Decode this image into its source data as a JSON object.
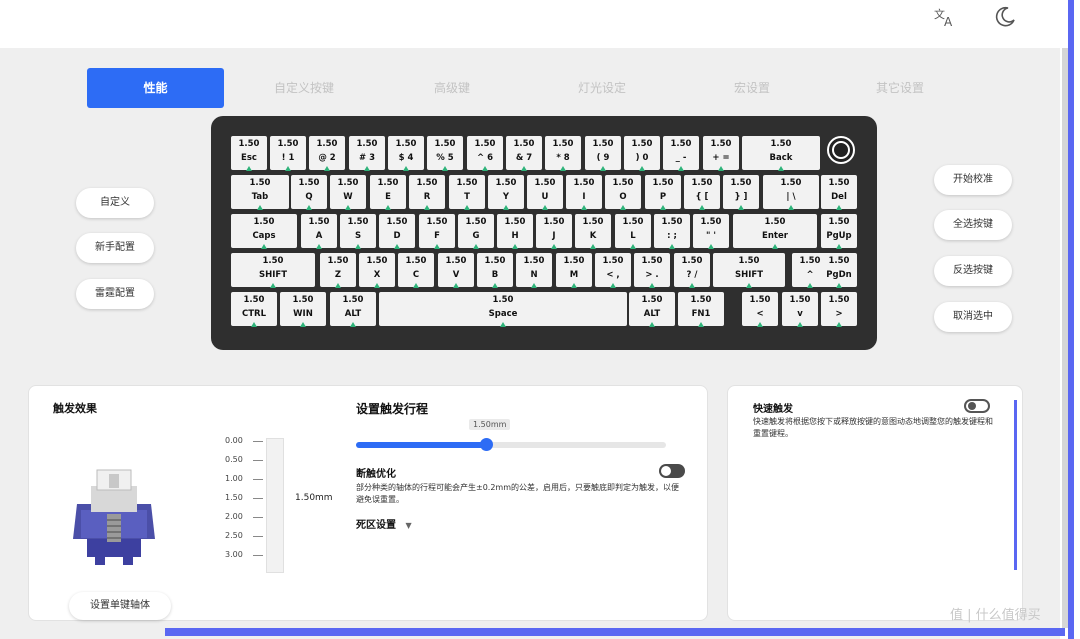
{
  "topbar": {
    "translate_icon": "translate-icon",
    "theme_icon": "moon-icon"
  },
  "tabs": [
    {
      "label": "性能",
      "active": true
    },
    {
      "label": "自定义按键",
      "active": false
    },
    {
      "label": "高级键",
      "active": false
    },
    {
      "label": "灯光设定",
      "active": false
    },
    {
      "label": "宏设置",
      "active": false
    },
    {
      "label": "其它设置",
      "active": false
    }
  ],
  "keyboard": {
    "accent": "#2fb37a",
    "rows": [
      [
        {
          "v": "1.50",
          "l": "Esc"
        },
        {
          "v": "1.50",
          "l": "! 1"
        },
        {
          "v": "1.50",
          "l": "@ 2"
        },
        {
          "v": "1.50",
          "l": "# 3"
        },
        {
          "v": "1.50",
          "l": "$ 4"
        },
        {
          "v": "1.50",
          "l": "% 5"
        },
        {
          "v": "1.50",
          "l": "^ 6"
        },
        {
          "v": "1.50",
          "l": "& 7"
        },
        {
          "v": "1.50",
          "l": "* 8"
        },
        {
          "v": "1.50",
          "l": "( 9"
        },
        {
          "v": "1.50",
          "l": ") 0"
        },
        {
          "v": "1.50",
          "l": "_ -"
        },
        {
          "v": "1.50",
          "l": "+ ="
        },
        {
          "v": "1.50",
          "l": "Back"
        }
      ],
      [
        {
          "v": "1.50",
          "l": "Tab"
        },
        {
          "v": "1.50",
          "l": "Q"
        },
        {
          "v": "1.50",
          "l": "W"
        },
        {
          "v": "1.50",
          "l": "E"
        },
        {
          "v": "1.50",
          "l": "R"
        },
        {
          "v": "1.50",
          "l": "T"
        },
        {
          "v": "1.50",
          "l": "Y"
        },
        {
          "v": "1.50",
          "l": "U"
        },
        {
          "v": "1.50",
          "l": "I"
        },
        {
          "v": "1.50",
          "l": "O"
        },
        {
          "v": "1.50",
          "l": "P"
        },
        {
          "v": "1.50",
          "l": "{ ["
        },
        {
          "v": "1.50",
          "l": "} ]"
        },
        {
          "v": "1.50",
          "l": "| \\"
        },
        {
          "v": "1.50",
          "l": "Del"
        }
      ],
      [
        {
          "v": "1.50",
          "l": "Caps"
        },
        {
          "v": "1.50",
          "l": "A"
        },
        {
          "v": "1.50",
          "l": "S"
        },
        {
          "v": "1.50",
          "l": "D"
        },
        {
          "v": "1.50",
          "l": "F"
        },
        {
          "v": "1.50",
          "l": "G"
        },
        {
          "v": "1.50",
          "l": "H"
        },
        {
          "v": "1.50",
          "l": "J"
        },
        {
          "v": "1.50",
          "l": "K"
        },
        {
          "v": "1.50",
          "l": "L"
        },
        {
          "v": "1.50",
          "l": ": ;"
        },
        {
          "v": "1.50",
          "l": "\" '"
        },
        {
          "v": "1.50",
          "l": "Enter"
        },
        {
          "v": "1.50",
          "l": "PgUp"
        }
      ],
      [
        {
          "v": "1.50",
          "l": "SHIFT"
        },
        {
          "v": "1.50",
          "l": "Z"
        },
        {
          "v": "1.50",
          "l": "X"
        },
        {
          "v": "1.50",
          "l": "C"
        },
        {
          "v": "1.50",
          "l": "V"
        },
        {
          "v": "1.50",
          "l": "B"
        },
        {
          "v": "1.50",
          "l": "N"
        },
        {
          "v": "1.50",
          "l": "M"
        },
        {
          "v": "1.50",
          "l": "< ,"
        },
        {
          "v": "1.50",
          "l": "> ."
        },
        {
          "v": "1.50",
          "l": "? /"
        },
        {
          "v": "1.50",
          "l": "SHIFT"
        },
        {
          "v": "1.50",
          "l": "^"
        },
        {
          "v": "1.50",
          "l": "PgDn"
        }
      ],
      [
        {
          "v": "1.50",
          "l": "CTRL"
        },
        {
          "v": "1.50",
          "l": "WIN"
        },
        {
          "v": "1.50",
          "l": "ALT"
        },
        {
          "v": "1.50",
          "l": "Space"
        },
        {
          "v": "1.50",
          "l": "ALT"
        },
        {
          "v": "1.50",
          "l": "FN1"
        },
        {
          "v": "1.50",
          "l": "<"
        },
        {
          "v": "1.50",
          "l": "v"
        },
        {
          "v": "1.50",
          "l": ">"
        }
      ]
    ]
  },
  "left_buttons": [
    "自定义",
    "新手配置",
    "雷霆配置"
  ],
  "right_buttons": [
    "开始校准",
    "全选按键",
    "反选按键",
    "取消选中"
  ],
  "trigger_panel": {
    "title": "触发效果",
    "scale": [
      "0.00",
      "0.50",
      "1.00",
      "1.50",
      "2.00",
      "2.50",
      "3.00"
    ],
    "current_value": "1.50mm",
    "set_single_btn": "设置单键轴体"
  },
  "travel_panel": {
    "title": "设置触发行程",
    "slider_label": "1.50mm",
    "slider_fraction": 0.42,
    "optimize_title": "断触优化",
    "optimize_desc": "部分种类的轴体的行程可能会产生±0.2mm的公差，启用后，只要触底即判定为触发，以便避免误重置。",
    "deadzone": "死区设置",
    "optimize_on": true
  },
  "rapid_panel": {
    "title": "快速触发",
    "desc": "快速触发将根据您按下或释放按键的意图动态地调整您的触发键程和重置键程。",
    "on": false
  },
  "watermark": "值 | 什么值得买"
}
